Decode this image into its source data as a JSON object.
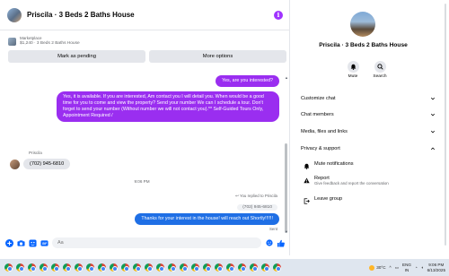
{
  "chat": {
    "title": "Priscila · 3 Beds 2 Baths House",
    "marketplace": {
      "label": "Marketplace",
      "listing": "$1,240 · 3 Beds 2 Baths House"
    },
    "actions": {
      "mark_pending": "Mark as pending",
      "more_options": "More options"
    },
    "messages": {
      "out_question": "Yes, are you interested?",
      "out_long": "Yes, it is available. If you are interested,  Am contact you I will detail you.  When would be a good time for you to come and view the property? Send your number We can I schedule a tour.  Don't forget to send your number (Without number we will not contact you).** Self-Guided Tours Only, Appointment Required /",
      "sender": "Priscila",
      "in_phone": "(702) 945-6810",
      "timestamp": "9:06 PM",
      "replied_to": "You replied to Priscila",
      "quoted": "(702) 945-6810",
      "out_reply": "Thanks for your interest in the house! will reach out Shortly!!!!!!",
      "sent_status": "Sent"
    },
    "composer": {
      "placeholder": "Aa"
    }
  },
  "info_panel": {
    "name": "Priscila · 3 Beds 2 Baths House",
    "mute_label": "Mute",
    "search_label": "Search",
    "sections": {
      "customize": "Customize chat",
      "members": "Chat members",
      "media": "Media, files and links",
      "privacy": "Privacy & support"
    },
    "privacy_items": {
      "mute_notifications": "Mute notifications",
      "report": "Report",
      "report_desc": "Give feedback and report the conversation",
      "leave": "Leave group"
    }
  },
  "taskbar": {
    "weather_temp": "30°C",
    "language": "ENG",
    "region": "IN",
    "time": "9:06 PM",
    "date": "6/13/2025"
  },
  "colors": {
    "accent_purple": "#9a2ef0",
    "accent_blue": "#1f6fe5",
    "messenger_blue": "#0866ff"
  },
  "icons": {
    "info": "info-icon",
    "mute": "bell-icon",
    "search": "search-icon",
    "report": "warning-icon",
    "leave": "leave-icon",
    "like": "thumbs-up-icon"
  }
}
